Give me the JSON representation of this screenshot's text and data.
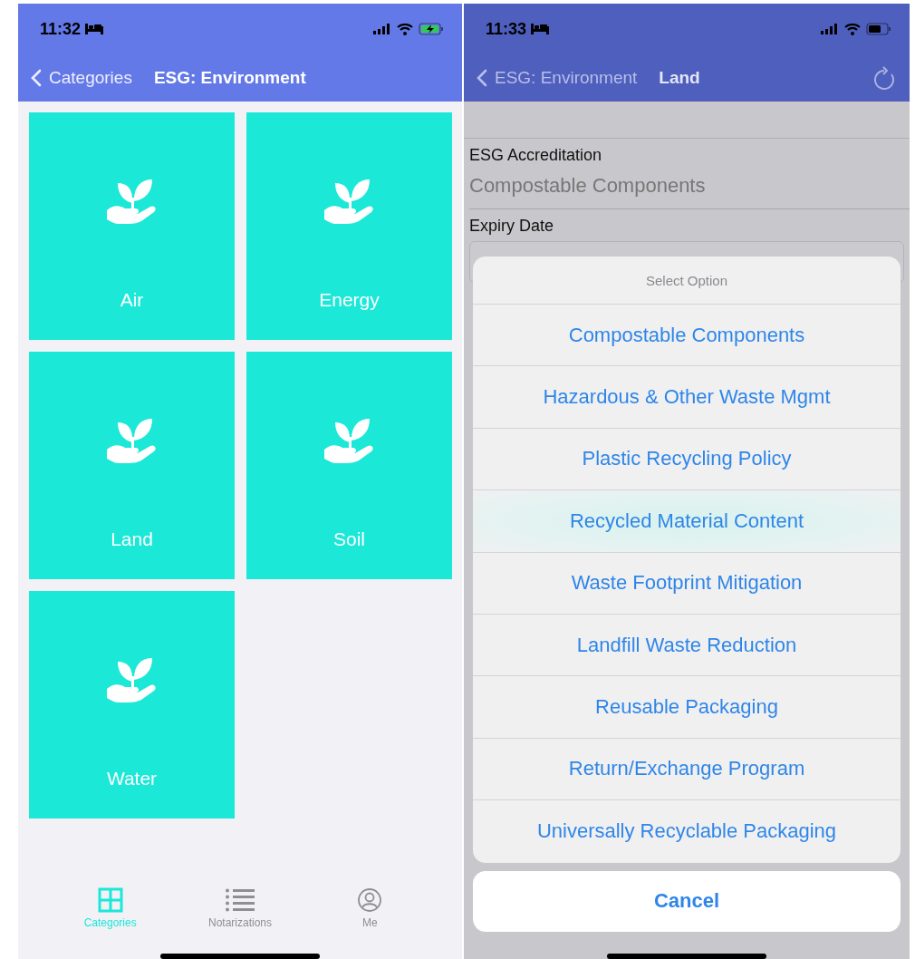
{
  "left_screen": {
    "status_bar": {
      "time": "11:32",
      "charging": true
    },
    "nav_bar": {
      "back_label": "Categories",
      "title": "ESG: Environment"
    },
    "tiles": [
      {
        "label": "Air"
      },
      {
        "label": "Energy"
      },
      {
        "label": "Land"
      },
      {
        "label": "Soil"
      },
      {
        "label": "Water"
      }
    ],
    "tab_bar": [
      {
        "label": "Categories",
        "kind": "grid",
        "selected": true
      },
      {
        "label": "Notarizations",
        "kind": "list",
        "selected": false
      },
      {
        "label": "Me",
        "kind": "person",
        "selected": false
      }
    ]
  },
  "right_screen": {
    "status_bar": {
      "time": "11:33",
      "charging": false
    },
    "nav_bar": {
      "back_label": "ESG: Environment",
      "title": "Land"
    },
    "form": [
      {
        "label": "ESG Accreditation",
        "kind": "value",
        "value": "Compostable Components"
      },
      {
        "label": "Expiry Date",
        "kind": "input"
      }
    ],
    "action_sheet": {
      "title": "Select Option",
      "options": [
        {
          "label": "Compostable Components",
          "highlighted": false
        },
        {
          "label": "Hazardous & Other Waste Mgmt",
          "highlighted": false
        },
        {
          "label": "Plastic Recycling Policy",
          "highlighted": false
        },
        {
          "label": "Recycled Material Content",
          "highlighted": true
        },
        {
          "label": "Waste Footprint Mitigation",
          "highlighted": false
        },
        {
          "label": "Landfill Waste Reduction",
          "highlighted": false
        },
        {
          "label": "Reusable Packaging",
          "highlighted": false
        },
        {
          "label": "Return/Exchange Program",
          "highlighted": false
        },
        {
          "label": "Universally Recyclable Packaging",
          "highlighted": false
        }
      ],
      "cancel": "Cancel"
    }
  }
}
